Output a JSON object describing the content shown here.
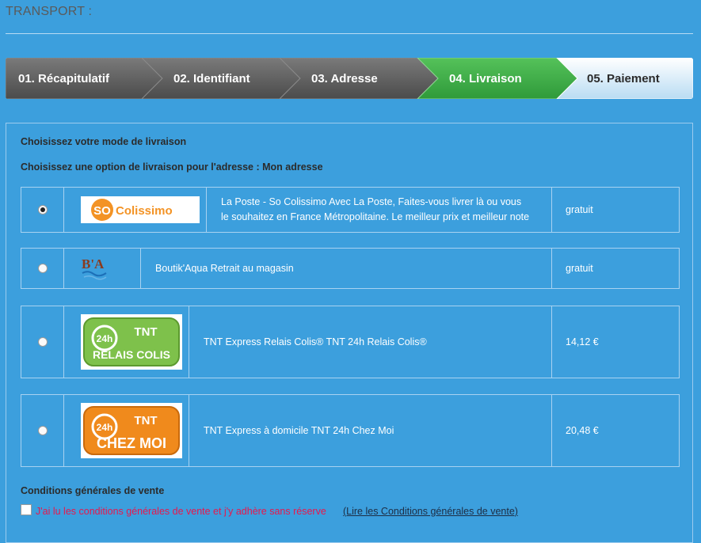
{
  "page": {
    "title": "TRANSPORT :"
  },
  "steps": [
    {
      "label": "01. Récapitulatif",
      "state": "done"
    },
    {
      "label": "02. Identifiant",
      "state": "done"
    },
    {
      "label": "03. Adresse",
      "state": "done"
    },
    {
      "label": "04. Livraison",
      "state": "current"
    },
    {
      "label": "05. Paiement",
      "state": "upcoming"
    }
  ],
  "colors": {
    "background": "#3c9fdd",
    "step_done": "#5f5f5f",
    "step_current": "#3fae49",
    "step_upcoming": "#d6ecfa",
    "cgv_text": "#e8174d"
  },
  "delivery": {
    "heading": "Choisissez votre mode de livraison",
    "subheading": "Choisissez une option de livraison pour l'adresse : Mon adresse",
    "carriers": [
      {
        "logo": "so-colissimo-logo",
        "logo_text_so": "SO",
        "logo_text": "Colissimo",
        "description_line1": "La Poste - So Colissimo Avec La Poste, Faites-vous livrer là ou vous",
        "description_line2": "le souhaitez en France Métropolitaine. Le meilleur prix et meilleur note",
        "price": "gratuit",
        "selected": true
      },
      {
        "logo": "boutikaqua-logo",
        "logo_text": "B'A",
        "description": "Boutik'Aqua Retrait au magasin",
        "price": "gratuit",
        "selected": false
      },
      {
        "logo": "tnt-relais-colis-logo",
        "logo_line1": "24h",
        "logo_brand": "TNT",
        "logo_line2": "RELAIS COLIS",
        "description": "TNT Express Relais Colis® TNT 24h Relais Colis®",
        "price": "14,12 €",
        "selected": false
      },
      {
        "logo": "tnt-chez-moi-logo",
        "logo_line1": "24h",
        "logo_brand": "TNT",
        "logo_line2": "CHEZ MOI",
        "description": "TNT Express à domicile TNT 24h Chez Moi",
        "price": "20,48 €",
        "selected": false
      }
    ]
  },
  "cgv": {
    "heading": "Conditions générales de vente",
    "checkbox_label": "J'ai lu les conditions générales de vente et j'y adhère sans réserve",
    "link_text": "(Lire les Conditions générales de vente)",
    "checked": false
  }
}
